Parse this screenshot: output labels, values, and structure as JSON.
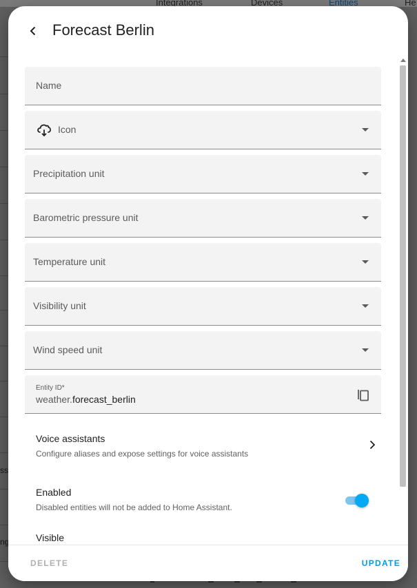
{
  "background": {
    "tabs": [
      "Integrations",
      "Devices",
      "Entities",
      "He"
    ],
    "row_fragments": [
      "ss",
      "ng"
    ]
  },
  "dialog": {
    "title": "Forecast Berlin",
    "fields": {
      "name": {
        "label": "Name"
      },
      "icon": {
        "label": "Icon",
        "icon_name": "cloud-sync-icon"
      },
      "precipitation_unit": {
        "label": "Precipitation unit"
      },
      "barometric_pressure_unit": {
        "label": "Barometric pressure unit"
      },
      "temperature_unit": {
        "label": "Temperature unit"
      },
      "visibility_unit": {
        "label": "Visibility unit"
      },
      "wind_speed_unit": {
        "label": "Wind speed unit"
      },
      "entity_id": {
        "label": "Entity ID*",
        "prefix": "weather.",
        "value": "forecast_berlin"
      }
    },
    "voice_assistants": {
      "title": "Voice assistants",
      "subtitle": "Configure aliases and expose settings for voice assistants"
    },
    "enabled": {
      "title": "Enabled",
      "subtitle": "Disabled entities will not be added to Home Assistant.",
      "checked": true
    },
    "visible": {
      "title": "Visible"
    },
    "footer": {
      "delete_label": "DELETE",
      "update_label": "UPDATE"
    },
    "colors": {
      "accent": "#03a9f4",
      "accent_text": "#039be5",
      "disabled_text": "#b0b0b0"
    }
  }
}
